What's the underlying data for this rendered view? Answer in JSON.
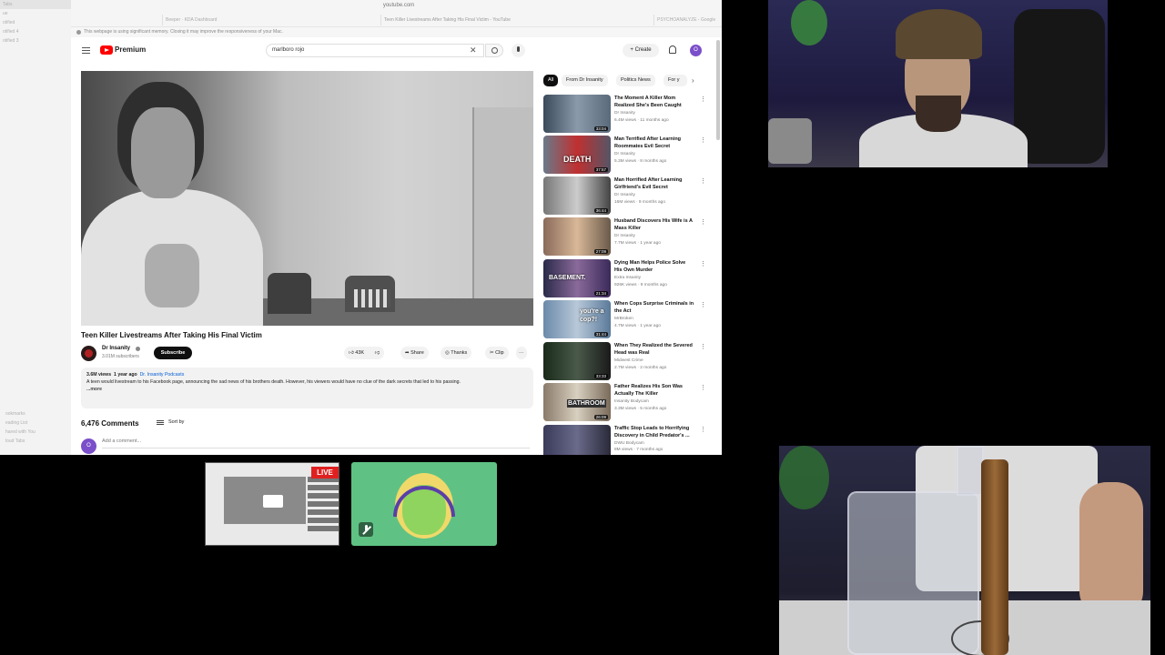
{
  "browser": {
    "url": "youtube.com",
    "sidebar_items": [
      "Tabs",
      "ue",
      "otified",
      "otified 4",
      "otified 3"
    ],
    "sidebar_bottom": [
      "ookmarks",
      "eading List",
      "hared with You",
      "loud Tabs"
    ],
    "tabs": [
      "Beeper · KDA Dashboard",
      "Teen Killer Livestreams After Taking His Final Victim - YouTube",
      "PSYCHOANALYZE - Google"
    ],
    "memory_warning": "This webpage is using significant memory. Closing it may improve the responsiveness of your Mac."
  },
  "header": {
    "brand": "Premium",
    "search_value": "marlboro rojo",
    "create_label": "Create",
    "avatar_letter": "O"
  },
  "video": {
    "title": "Teen Killer Livestreams After Taking His Final Victim",
    "channel": "Dr Insanity",
    "subscribers": "3.01M subscribers",
    "subscribe_label": "Subscribe",
    "likes": "43K",
    "share_label": "Share",
    "thanks_label": "Thanks",
    "clip_label": "Clip",
    "more_label": "···",
    "views": "3.6M views",
    "age": "1 year ago",
    "channel_link": "Dr. Insanity Podcasts",
    "description": "A teen would livestream to his Facebook page, announcing the sad news of his brothers death. However, his viewers would have no clue of the dark secrets that led to his passing.",
    "more": "...more"
  },
  "comments": {
    "count": "6,476 Comments",
    "sort_label": "Sort by",
    "placeholder": "Add a comment..."
  },
  "chips": [
    "All",
    "From Dr Insanity",
    "Politics News",
    "For y"
  ],
  "recommendations": [
    {
      "title": "The Moment A Killer Mom Realized She's Been Caught",
      "channel": "Dr Insanity",
      "meta": "6.4M views · 11 months ago",
      "duration": "33:04",
      "caption": ""
    },
    {
      "title": "Man Terrified After Learning Roommates Evil Secret",
      "channel": "Dr Insanity",
      "meta": "5.3M views · 8 months ago",
      "duration": "37:57",
      "caption": "DEATH"
    },
    {
      "title": "Man Horrified After Learning Girlfriend's Evil Secret",
      "channel": "Dr Insanity",
      "meta": "16M views · 9 months ago",
      "duration": "36:44",
      "caption": ""
    },
    {
      "title": "Husband Discovers His Wife is A Mass Killer",
      "channel": "Dr Insanity",
      "meta": "7.7M views · 1 year ago",
      "duration": "27:09",
      "caption": ""
    },
    {
      "title": "Dying Man Helps Police Solve His Own Murder",
      "channel": "Extra Insanity",
      "meta": "926K views · 9 months ago",
      "duration": "21:34",
      "caption": "BASEMENT."
    },
    {
      "title": "When Cops Surprise Criminals in the Act",
      "channel": "MrBroken",
      "meta": "4.7M views · 1 year ago",
      "duration": "31:44",
      "caption": "you're a cop?!"
    },
    {
      "title": "When They Realized the Severed Head was Real",
      "channel": "Midwest Crime",
      "meta": "2.7M views · 2 months ago",
      "duration": "33:33",
      "caption": ""
    },
    {
      "title": "Father Realizes His Son Was Actually The Killer",
      "channel": "Insanity Bodycam",
      "meta": "3.3M views · 5 months ago",
      "duration": "26:09",
      "caption": "BATHROOM"
    },
    {
      "title": "Traffic Stop Leads to Horrifying Discovery in Child Predator's ...",
      "channel": "DWU Bodycam",
      "meta": "8M views · 7 months ago",
      "duration": "",
      "caption": ""
    }
  ],
  "overlay": {
    "live_label": "LIVE"
  },
  "colors": {
    "youtube_red": "#ff0000",
    "live_red": "#e02020",
    "avatar_purple": "#7b4fc9",
    "widget_green": "#5fc284"
  },
  "icons": [
    "menu-icon",
    "youtube-logo-icon",
    "search-icon",
    "mic-icon",
    "bell-icon",
    "like-icon",
    "dislike-icon",
    "share-icon",
    "thanks-icon",
    "clip-icon",
    "sort-icon",
    "mute-icon",
    "kebab-icon"
  ]
}
